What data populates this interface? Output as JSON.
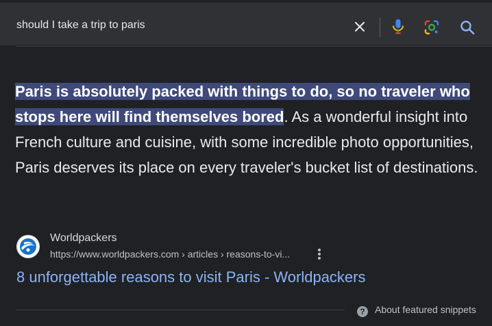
{
  "search": {
    "query": "should I take a trip to paris"
  },
  "snippet": {
    "highlight": "Paris is absolutely packed with things to do, so no traveler who stops here will find themselves bored",
    "rest": ". As a wonderful insight into French culture and cuisine, with some incredible photo opportunities, Paris deserves its place on every traveler's bucket list of destinations."
  },
  "result": {
    "site_name": "Worldpackers",
    "url": "https://www.worldpackers.com › articles › reasons-to-vi...",
    "title": "8 unforgettable reasons to visit Paris - Worldpackers"
  },
  "footer": {
    "help_glyph": "?",
    "about_label": "About featured snippets"
  },
  "icons": {
    "clear": "close-icon",
    "mic": "microphone-icon",
    "lens": "google-lens-icon",
    "search": "search-icon",
    "favicon": "worldpackers-logo",
    "more": "more-vert-icon"
  },
  "colors": {
    "background": "#202124",
    "highlight": "#3f4a7a",
    "link": "#8ab4f8"
  }
}
